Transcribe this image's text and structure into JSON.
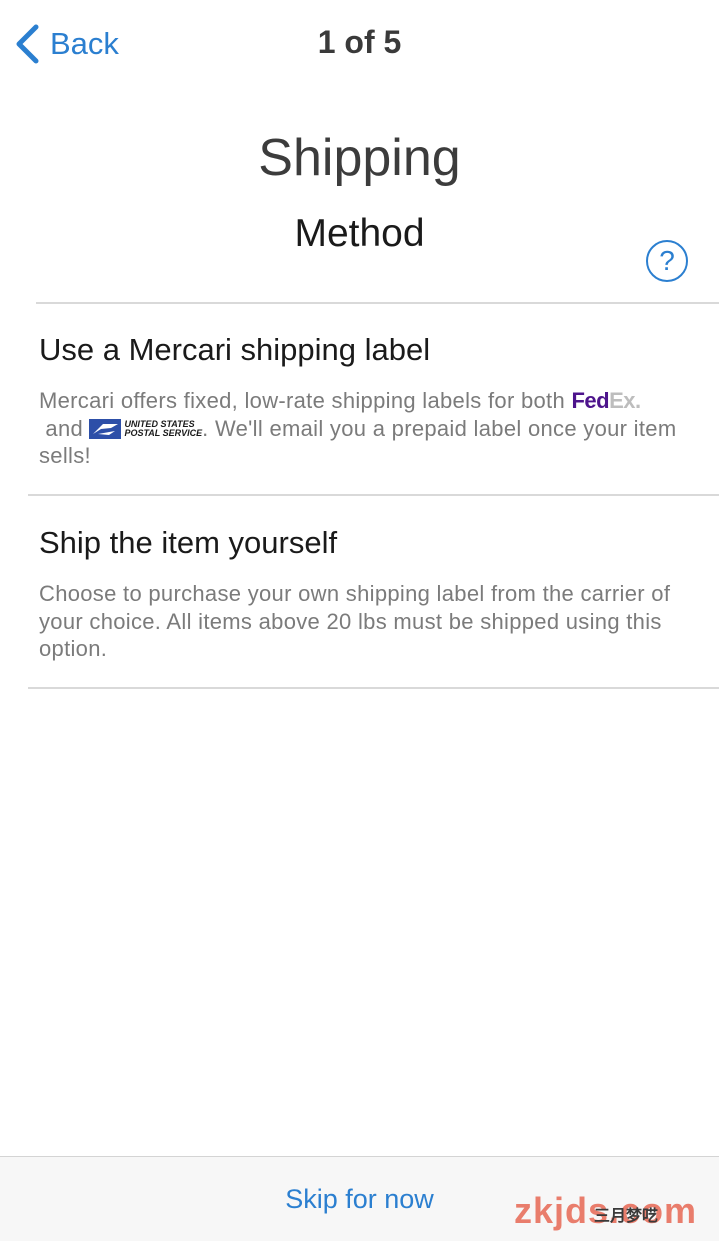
{
  "nav": {
    "back_label": "Back",
    "step": "1 of 5"
  },
  "header": {
    "title": "Shipping",
    "subtitle": "Method",
    "help_symbol": "?"
  },
  "options": [
    {
      "title": "Use a Mercari shipping label",
      "desc_part1": "Mercari offers fixed, low-rate shipping labels for both",
      "fedex_fed": "Fed",
      "fedex_ex": "Ex.",
      "and": " and ",
      "usps_line1": "UNITED STATES",
      "usps_line2": "POSTAL SERVICE",
      "desc_part2": ". We'll email you a prepaid label once your item sells!"
    },
    {
      "title": "Ship the item yourself",
      "desc": "Choose to purchase your own shipping label from the carrier of your choice. All items above 20 lbs must be shipped using this option."
    }
  ],
  "footer": {
    "skip_label": "Skip for now"
  },
  "watermark": {
    "text": "zkjds.com",
    "sub": "三月梦呓"
  },
  "colors": {
    "accent": "#2b7fd0",
    "fedex_purple": "#4d148c",
    "usps_blue": "#2d4fa8"
  }
}
